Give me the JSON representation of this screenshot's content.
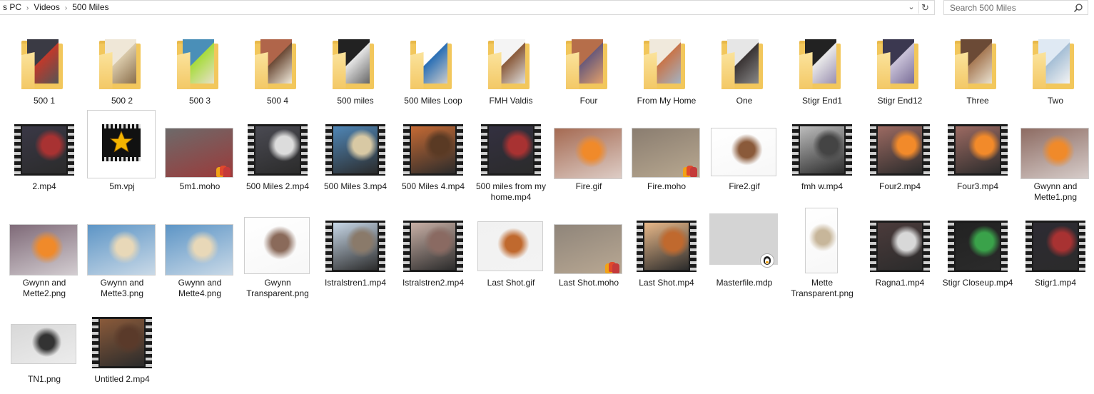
{
  "address": {
    "breadcrumbs": [
      "s PC",
      "Videos",
      "500 Miles"
    ],
    "dropdown_icon": "chevron-down-icon",
    "refresh_icon": "refresh-icon"
  },
  "search": {
    "placeholder": "Search 500 Miles",
    "icon": "search-icon"
  },
  "items": [
    {
      "name": "500 1",
      "type": "folder"
    },
    {
      "name": "500 2",
      "type": "folder"
    },
    {
      "name": "500 3",
      "type": "folder"
    },
    {
      "name": "500 4",
      "type": "folder"
    },
    {
      "name": "500 miles",
      "type": "folder"
    },
    {
      "name": "500 Miles Loop",
      "type": "folder"
    },
    {
      "name": "FMH Valdis",
      "type": "folder"
    },
    {
      "name": "Four",
      "type": "folder"
    },
    {
      "name": "From My Home",
      "type": "folder"
    },
    {
      "name": "One",
      "type": "folder"
    },
    {
      "name": "Stigr End1",
      "type": "folder"
    },
    {
      "name": "Stigr End12",
      "type": "folder"
    },
    {
      "name": "Three",
      "type": "folder"
    },
    {
      "name": "Two",
      "type": "folder"
    },
    {
      "name": "2.mp4",
      "type": "video"
    },
    {
      "name": "5m.vpj",
      "type": "project"
    },
    {
      "name": "5m1.moho",
      "type": "moho"
    },
    {
      "name": "500 Miles 2.mp4",
      "type": "video"
    },
    {
      "name": "500 Miles 3.mp4",
      "type": "video"
    },
    {
      "name": "500 Miles 4.mp4",
      "type": "video"
    },
    {
      "name": "500 miles from my home.mp4",
      "type": "video"
    },
    {
      "name": "Fire.gif",
      "type": "image"
    },
    {
      "name": "Fire.moho",
      "type": "moho"
    },
    {
      "name": "Fire2.gif",
      "type": "image"
    },
    {
      "name": "fmh w.mp4",
      "type": "video"
    },
    {
      "name": "Four2.mp4",
      "type": "video"
    },
    {
      "name": "Four3.mp4",
      "type": "video"
    },
    {
      "name": "Gwynn and Mette1.png",
      "type": "image"
    },
    {
      "name": "Gwynn and Mette2.png",
      "type": "image"
    },
    {
      "name": "Gwynn and Mette3.png",
      "type": "image"
    },
    {
      "name": "Gwynn and Mette4.png",
      "type": "image"
    },
    {
      "name": "Gwynn Transparent.png",
      "type": "image"
    },
    {
      "name": "Istralstren1.mp4",
      "type": "video"
    },
    {
      "name": "Istralstren2.mp4",
      "type": "video"
    },
    {
      "name": "Last Shot.gif",
      "type": "image"
    },
    {
      "name": "Last Shot.moho",
      "type": "moho"
    },
    {
      "name": "Last Shot.mp4",
      "type": "video"
    },
    {
      "name": "Masterfile.mdp",
      "type": "mdp"
    },
    {
      "name": "Mette Transparent.png",
      "type": "image"
    },
    {
      "name": "Ragna1.mp4",
      "type": "video"
    },
    {
      "name": "Stigr Closeup.mp4",
      "type": "video"
    },
    {
      "name": "Stigr1.mp4",
      "type": "video"
    },
    {
      "name": "TN1.png",
      "type": "image"
    },
    {
      "name": "Untitled 2.mp4",
      "type": "video"
    }
  ],
  "colors": {
    "folder": "#f2c75c",
    "folder_front": "#f7d47a",
    "film": "#1b1b1b",
    "star": "#f4b400"
  }
}
